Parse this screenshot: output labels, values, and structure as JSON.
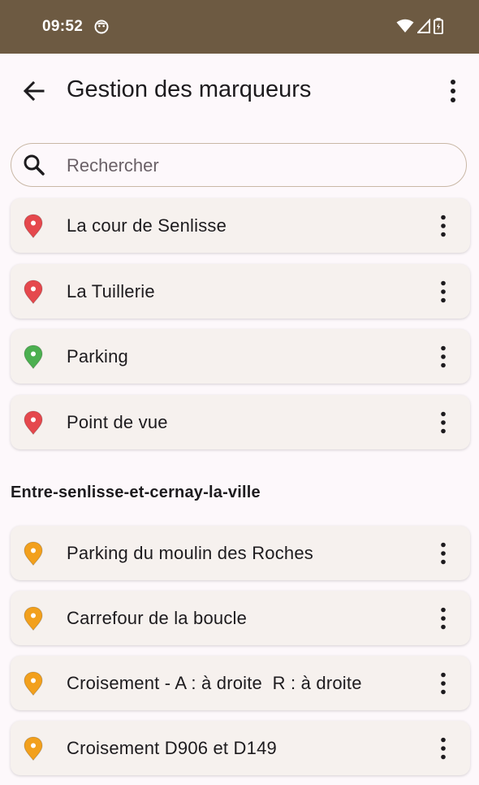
{
  "status_bar": {
    "time": "09:52",
    "icons": [
      "face-icon",
      "wifi-icon",
      "signal-icon",
      "battery-icon"
    ]
  },
  "app_bar": {
    "title": "Gestion des marqueurs",
    "back_icon": "arrow-back-icon",
    "menu_icon": "more-vert-icon"
  },
  "search": {
    "placeholder": "Rechercher",
    "value": ""
  },
  "colors": {
    "status_bar": "#6d5a42",
    "pin_red": "#e5484d",
    "pin_green": "#4caf50",
    "pin_orange": "#f2a01d"
  },
  "markers": [
    {
      "label": "La cour de Senlisse",
      "pin_color": "#e5484d"
    },
    {
      "label": "La Tuillerie",
      "pin_color": "#e5484d"
    },
    {
      "label": "Parking",
      "pin_color": "#4caf50"
    },
    {
      "label": "Point de vue",
      "pin_color": "#e5484d"
    }
  ],
  "group": {
    "title": "Entre-senlisse-et-cernay-la-ville",
    "markers": [
      {
        "label": "Parking du moulin des Roches",
        "pin_color": "#f2a01d"
      },
      {
        "label": "Carrefour de la boucle",
        "pin_color": "#f2a01d"
      },
      {
        "label": "Croisement - A : à droite  R : à droite",
        "pin_color": "#f2a01d"
      },
      {
        "label": "Croisement D906 et D149",
        "pin_color": "#f2a01d"
      }
    ]
  }
}
